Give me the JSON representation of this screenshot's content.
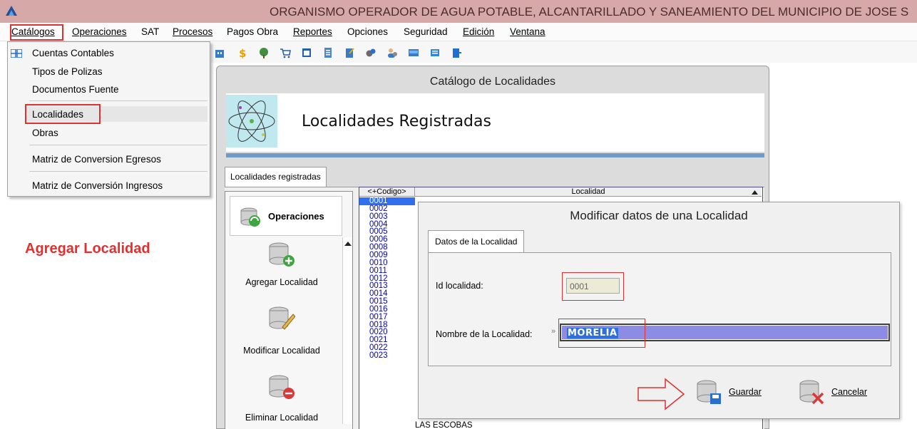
{
  "app": {
    "title": "ORGANISMO OPERADOR DE AGUA POTABLE, ALCANTARILLADO Y SANEAMIENTO DEL MUNICIPIO DE JOSE S",
    "titlebar_color": "#d7a8a8"
  },
  "menubar": {
    "items": [
      "Catálogos",
      "Operaciones",
      "SAT",
      "Procesos",
      "Pagos Obra",
      "Reportes",
      "Opciones",
      "Seguridad",
      "Edición",
      "Ventana"
    ]
  },
  "dropdown": {
    "items": [
      "Cuentas Contables",
      "Tipos de Polizas",
      "Documentos Fuente",
      "Localidades",
      "Obras",
      "Matriz de Conversion Egresos",
      "Matriz de Conversión Ingresos"
    ],
    "highlighted": "Localidades"
  },
  "annotation": {
    "note": "Agregar Localidad",
    "color": "#e62e2e"
  },
  "catalog_window": {
    "title": "Catálogo de Localidades",
    "header": "Localidades Registradas",
    "tab": "Localidades registradas"
  },
  "operations": {
    "title": "Operaciones",
    "actions": [
      "Agregar Localidad",
      "Modificar Localidad",
      "Eliminar Localidad"
    ]
  },
  "grid": {
    "columns": [
      "<+Codigo>",
      "Localidad"
    ],
    "codes": [
      "0001",
      "0002",
      "0003",
      "0004",
      "0005",
      "0006",
      "0008",
      "0009",
      "0010",
      "0011",
      "0012",
      "0013",
      "0014",
      "0015",
      "0016",
      "0017",
      "0018",
      "0020",
      "0021",
      "0022",
      "0023"
    ],
    "visible_localidad": "LAS ESCOBAS",
    "selected": "0001"
  },
  "modal": {
    "title": "Modificar datos de una Localidad",
    "tab": "Datos de la Localidad",
    "id_label": "Id localidad:",
    "id_value": "0001",
    "name_label": "Nombre de la Localidad:",
    "name_value": "MORELIA",
    "save_label": "Guardar",
    "cancel_label": "Cancelar"
  }
}
